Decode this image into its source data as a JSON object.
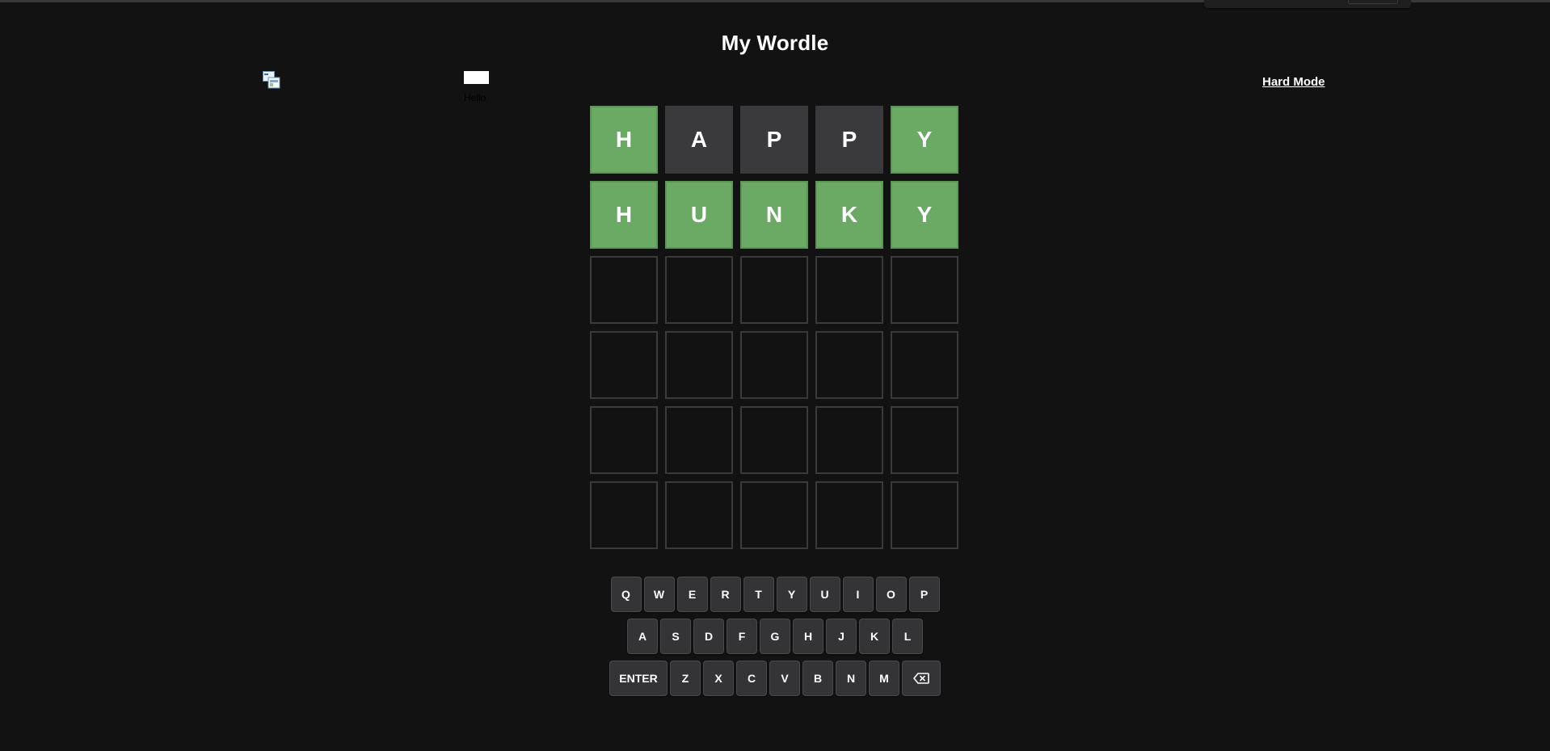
{
  "app": {
    "title": "My Wordle"
  },
  "header": {
    "hello_text": "Hello",
    "hard_mode_label": "Hard Mode"
  },
  "board": {
    "rows": [
      [
        {
          "letter": "H",
          "state": "correct"
        },
        {
          "letter": "A",
          "state": "absent"
        },
        {
          "letter": "P",
          "state": "absent"
        },
        {
          "letter": "P",
          "state": "absent"
        },
        {
          "letter": "Y",
          "state": "correct"
        }
      ],
      [
        {
          "letter": "H",
          "state": "correct"
        },
        {
          "letter": "U",
          "state": "correct"
        },
        {
          "letter": "N",
          "state": "correct"
        },
        {
          "letter": "K",
          "state": "correct"
        },
        {
          "letter": "Y",
          "state": "correct"
        }
      ],
      [
        {
          "letter": "",
          "state": "empty"
        },
        {
          "letter": "",
          "state": "empty"
        },
        {
          "letter": "",
          "state": "empty"
        },
        {
          "letter": "",
          "state": "empty"
        },
        {
          "letter": "",
          "state": "empty"
        }
      ],
      [
        {
          "letter": "",
          "state": "empty"
        },
        {
          "letter": "",
          "state": "empty"
        },
        {
          "letter": "",
          "state": "empty"
        },
        {
          "letter": "",
          "state": "empty"
        },
        {
          "letter": "",
          "state": "empty"
        }
      ],
      [
        {
          "letter": "",
          "state": "empty"
        },
        {
          "letter": "",
          "state": "empty"
        },
        {
          "letter": "",
          "state": "empty"
        },
        {
          "letter": "",
          "state": "empty"
        },
        {
          "letter": "",
          "state": "empty"
        }
      ],
      [
        {
          "letter": "",
          "state": "empty"
        },
        {
          "letter": "",
          "state": "empty"
        },
        {
          "letter": "",
          "state": "empty"
        },
        {
          "letter": "",
          "state": "empty"
        },
        {
          "letter": "",
          "state": "empty"
        }
      ]
    ]
  },
  "keyboard": {
    "rows": [
      [
        "Q",
        "W",
        "E",
        "R",
        "T",
        "Y",
        "U",
        "I",
        "O",
        "P"
      ],
      [
        "A",
        "S",
        "D",
        "F",
        "G",
        "H",
        "J",
        "K",
        "L"
      ],
      [
        "ENTER",
        "Z",
        "X",
        "C",
        "V",
        "B",
        "N",
        "M",
        "backspace-icon"
      ]
    ]
  },
  "colors": {
    "background": "#121213",
    "correct": "#6aaa64",
    "absent": "#3a3a3c",
    "key": "#343436",
    "empty_border": "#3a3a3c"
  }
}
